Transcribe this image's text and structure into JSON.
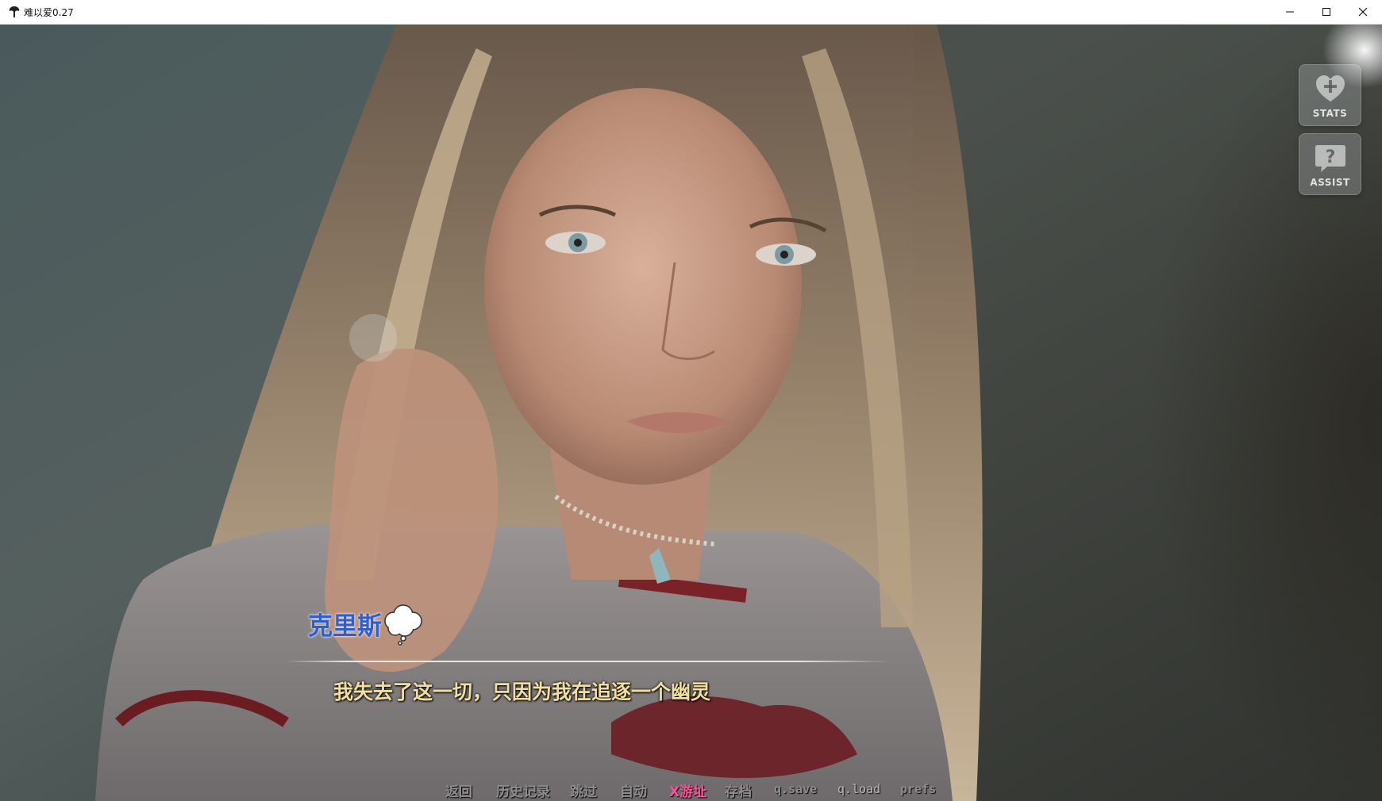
{
  "window": {
    "title": "难以爱0.27",
    "controls": [
      "minimize-icon",
      "maximize-icon",
      "close-icon"
    ]
  },
  "side_buttons": [
    {
      "label": "STATS",
      "icon": "heart-plus-icon"
    },
    {
      "label": "ASSIST",
      "icon": "question-bubble-icon"
    }
  ],
  "dialogue": {
    "speaker": "克里斯",
    "speaker_color": "#2f5ed4",
    "speaker_icon": "thought-bubble-icon",
    "text": "我失去了这一切，只因为我在追逐一个幽灵",
    "text_color": "#f2dfa0"
  },
  "quick_menu": {
    "items": [
      "返回",
      "历史记录",
      "跳过",
      "自动",
      "X游址",
      "存档",
      "q.save",
      "q.load",
      "prefs"
    ],
    "active_color": "#ff4f9a"
  }
}
